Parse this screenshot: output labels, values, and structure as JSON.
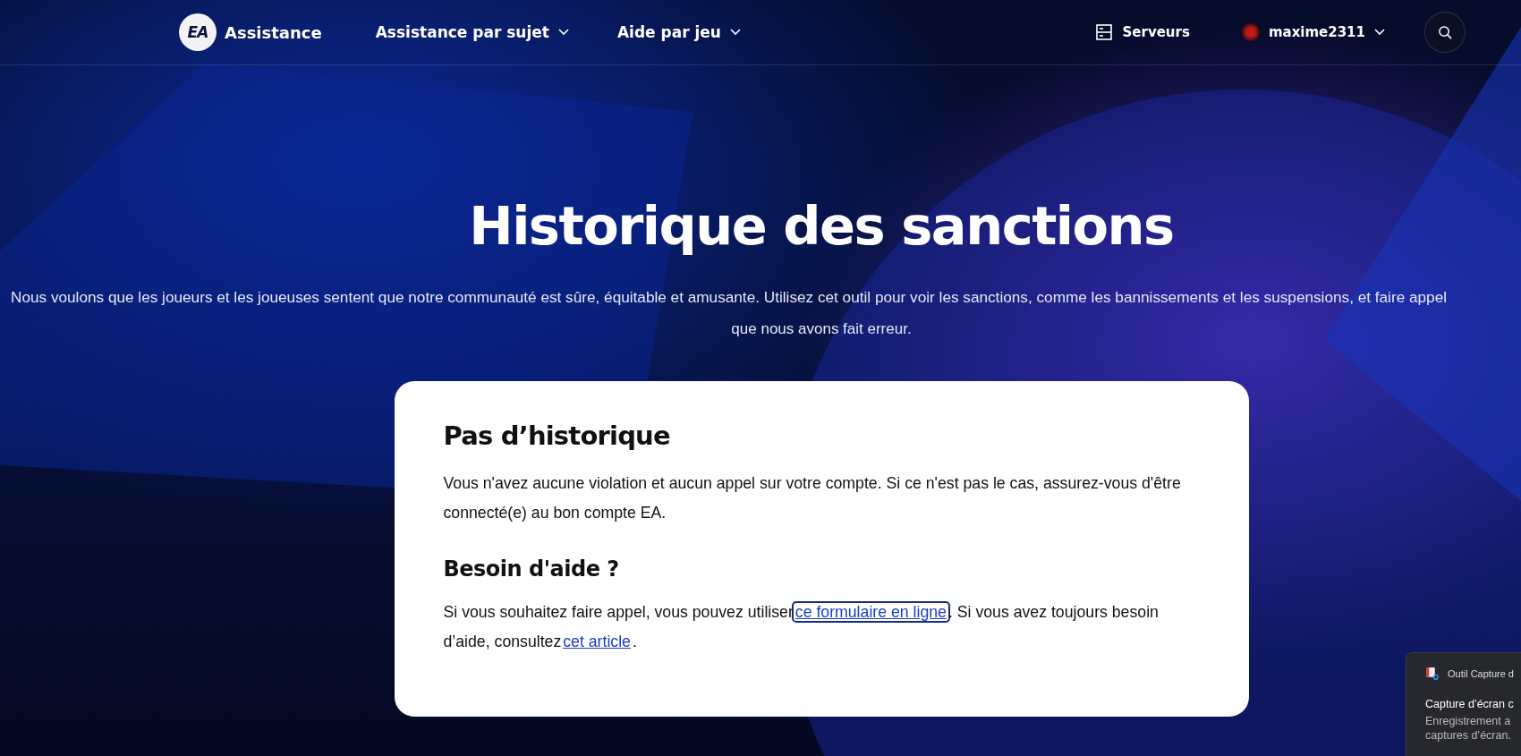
{
  "header": {
    "logo": "EA",
    "brand": "Assistance",
    "nav": [
      {
        "label": "Assistance par sujet"
      },
      {
        "label": "Aide par jeu"
      }
    ],
    "servers": "Serveurs",
    "user": "maxime2311"
  },
  "hero": {
    "title": "Historique des sanctions",
    "subtitle_lines": [
      "Nous voulons que les joueurs et les joueuses sentent que notre communauté est sûre, équitable et amusante. Utilisez cet outil pour voir les sanctions, comme les bannissements et les suspensions, et faire appel",
      "que nous avons fait erreur."
    ]
  },
  "card": {
    "heading": "Pas d’historique",
    "text": "Vous n'avez aucune violation et aucun appel sur votre compte. Si ce n'est pas le cas, assurez-vous d'être connecté(e) au bon compte EA.",
    "help_heading": "Besoin d'aide ?",
    "help_parts": [
      {
        "kind": "text",
        "text": "Si vous souhaitez faire appel, vous pouvez utiliser"
      },
      {
        "kind": "link",
        "text": "ce formulaire en ligne",
        "focused": true
      },
      {
        "kind": "text",
        "text": ". Si vous avez toujours besoin d’aide, consultez"
      },
      {
        "kind": "link",
        "text": "cet article",
        "focused": false
      },
      {
        "kind": "text",
        "text": "."
      }
    ]
  },
  "toast": {
    "app": "Outil Capture d",
    "title": "Capture d’écran c",
    "lines": [
      "Enregistrement a",
      "captures d’écran."
    ]
  }
}
